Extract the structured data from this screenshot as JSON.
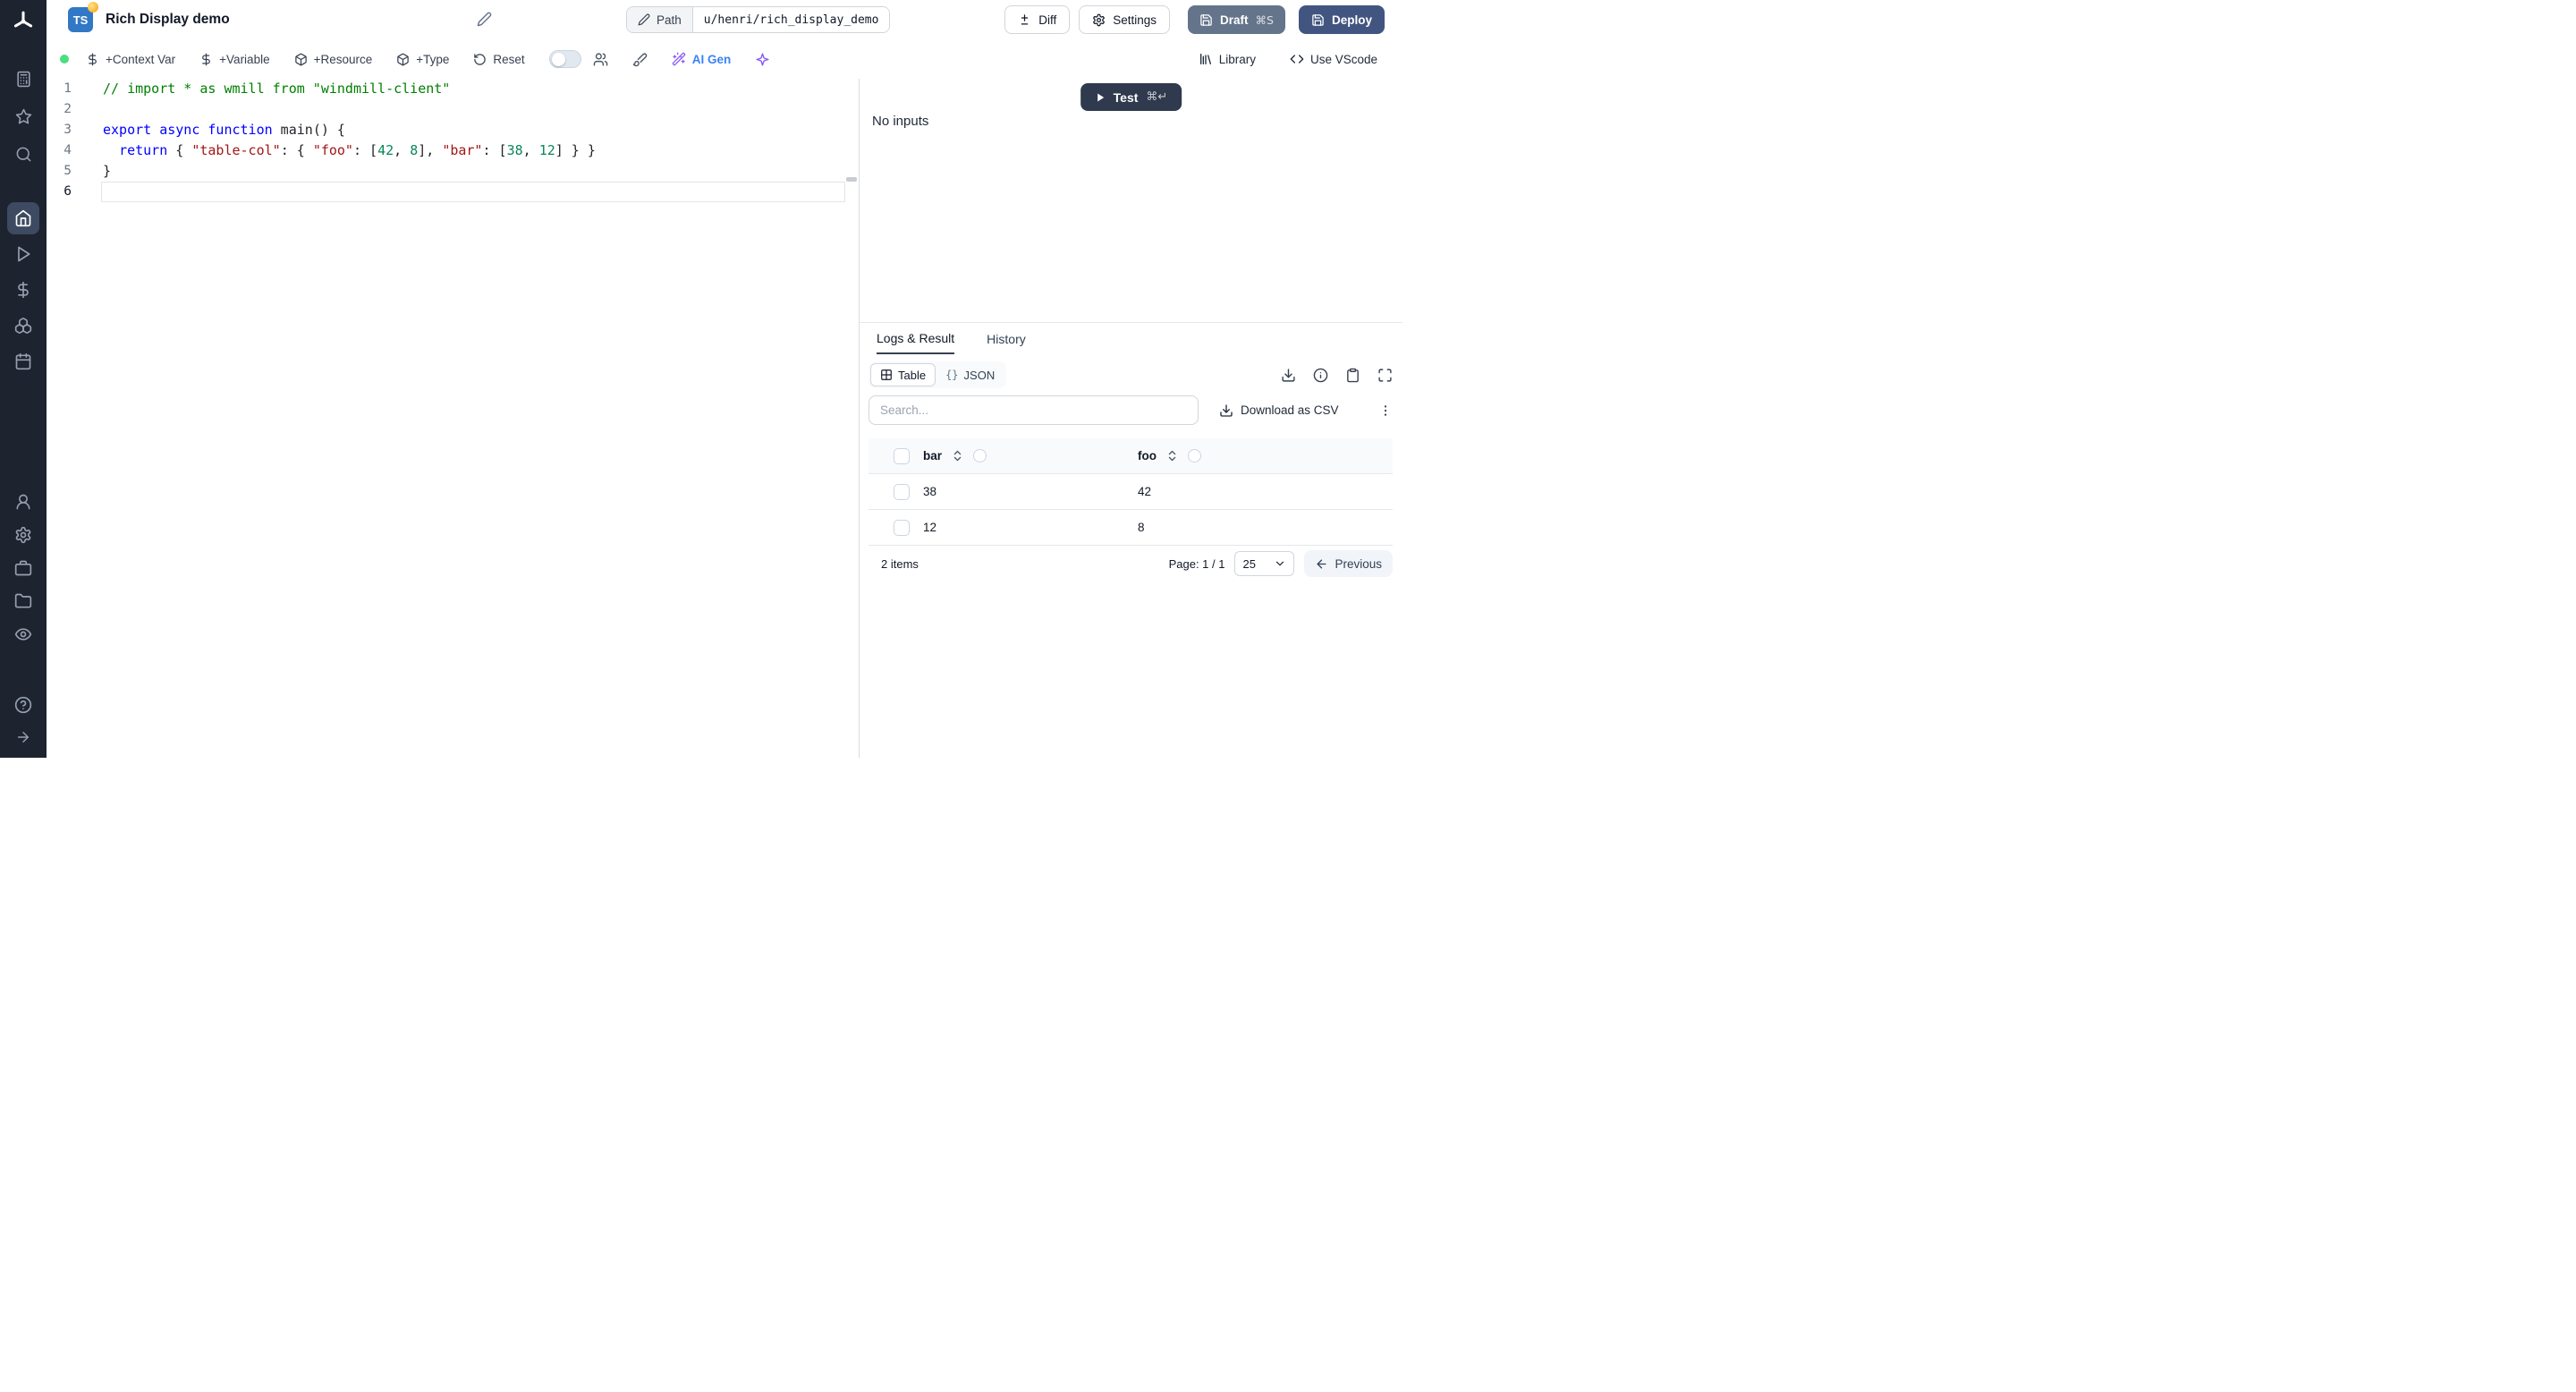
{
  "sidebar": {
    "logo": "windmill-logo",
    "top_icons": [
      "calculator-icon",
      "star-icon",
      "search-icon"
    ],
    "main_icons": [
      "home-icon",
      "play-icon",
      "dollar-icon",
      "boxes-icon",
      "calendar-icon"
    ],
    "active_icon": "home-icon",
    "lower_icons": [
      "user-icon",
      "gear-icon",
      "briefcase-icon",
      "folder-icon",
      "eye-icon"
    ],
    "footer_icons": [
      "help-icon",
      "arrow-right-icon"
    ]
  },
  "header": {
    "language_badge": "TS",
    "title": "Rich Display demo",
    "path_label": "Path",
    "path_value": "u/henri/rich_display_demo",
    "diff_label": "Diff",
    "settings_label": "Settings",
    "draft_label": "Draft",
    "draft_shortcut": "⌘S",
    "deploy_label": "Deploy"
  },
  "toolbar": {
    "context_var": "+Context Var",
    "variable": "+Variable",
    "resource": "+Resource",
    "type": "+Type",
    "reset": "Reset",
    "ai_gen": "AI Gen",
    "library": "Library",
    "vscode": "Use VScode"
  },
  "editor": {
    "line_numbers": [
      "1",
      "2",
      "3",
      "4",
      "5",
      "6"
    ],
    "lines": [
      {
        "tokens": [
          {
            "text": "// import * as wmill from \"windmill-client\"",
            "type": "comment"
          }
        ]
      },
      {
        "tokens": []
      },
      {
        "tokens": [
          {
            "text": "export",
            "type": "kw"
          },
          {
            "text": " ",
            "type": "plain"
          },
          {
            "text": "async",
            "type": "kw"
          },
          {
            "text": " ",
            "type": "plain"
          },
          {
            "text": "function",
            "type": "kw"
          },
          {
            "text": " main",
            "type": "plain"
          },
          {
            "text": "() {",
            "type": "plain"
          }
        ]
      },
      {
        "tokens": [
          {
            "text": "  ",
            "type": "plain"
          },
          {
            "text": "return",
            "type": "kw"
          },
          {
            "text": " { ",
            "type": "plain"
          },
          {
            "text": "\"table-col\"",
            "type": "str"
          },
          {
            "text": ": { ",
            "type": "plain"
          },
          {
            "text": "\"foo\"",
            "type": "str"
          },
          {
            "text": ": [",
            "type": "plain"
          },
          {
            "text": "42",
            "type": "num"
          },
          {
            "text": ", ",
            "type": "plain"
          },
          {
            "text": "8",
            "type": "num"
          },
          {
            "text": "], ",
            "type": "plain"
          },
          {
            "text": "\"bar\"",
            "type": "str"
          },
          {
            "text": ": [",
            "type": "plain"
          },
          {
            "text": "38",
            "type": "num"
          },
          {
            "text": ", ",
            "type": "plain"
          },
          {
            "text": "12",
            "type": "num"
          },
          {
            "text": "] } }",
            "type": "plain"
          }
        ]
      },
      {
        "tokens": [
          {
            "text": "}",
            "type": "plain"
          }
        ]
      },
      {
        "tokens": [],
        "current": true
      }
    ]
  },
  "run_panel": {
    "test_label": "Test",
    "test_shortcut": "⌘↵",
    "no_inputs": "No inputs"
  },
  "result_panel": {
    "tabs": [
      {
        "label": "Logs & Result",
        "active": true
      },
      {
        "label": "History",
        "active": false
      }
    ],
    "view_toggle": {
      "table_label": "Table",
      "json_prefix": "{}",
      "json_label": "JSON"
    },
    "action_icons": [
      "download-icon",
      "info-icon",
      "clipboard-icon",
      "expand-icon"
    ],
    "search_placeholder": "Search...",
    "download_csv_label": "Download as CSV",
    "table": {
      "columns": [
        "bar",
        "foo"
      ],
      "rows": [
        [
          "38",
          "42"
        ],
        [
          "12",
          "8"
        ]
      ],
      "items_text": "2 items",
      "page_text": "Page: 1 / 1",
      "page_size": "25",
      "previous_label": "Previous"
    }
  },
  "colors": {
    "sidebar_bg": "#1d232f",
    "active_item_bg": "#3d4a61",
    "status_green": "#4ade80",
    "accent_blue": "#3b82f6",
    "ai_violet": "#8b5cf6",
    "draft_bg": "#64748b",
    "deploy_bg": "#415580",
    "test_bg": "#2f3a4e",
    "ts_badge_bg": "#3178c6"
  }
}
